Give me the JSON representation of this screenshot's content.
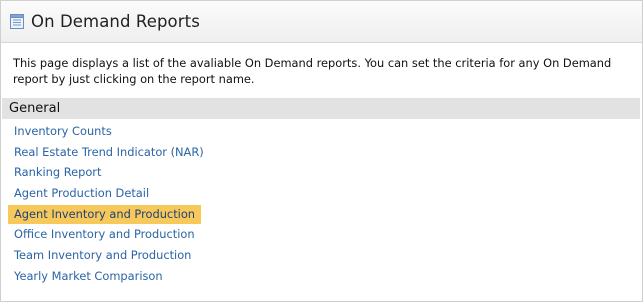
{
  "header": {
    "title": "On Demand Reports",
    "icon": "report-icon"
  },
  "description": "This page displays a list of the avaliable On Demand reports. You can set the criteria for any On Demand report by just clicking on the report name.",
  "section": {
    "title": "General",
    "items": [
      {
        "label": "Inventory Counts",
        "highlighted": false
      },
      {
        "label": "Real Estate Trend Indicator (NAR)",
        "highlighted": false
      },
      {
        "label": "Ranking Report",
        "highlighted": false
      },
      {
        "label": "Agent Production Detail",
        "highlighted": false
      },
      {
        "label": "Agent Inventory and Production",
        "highlighted": true
      },
      {
        "label": "Office Inventory and Production",
        "highlighted": false
      },
      {
        "label": "Team Inventory and Production",
        "highlighted": false
      },
      {
        "label": "Yearly Market Comparison",
        "highlighted": false
      }
    ]
  },
  "colors": {
    "link": "#2a64a6",
    "highlight": "#f7c95a",
    "section_bg": "#e2e2e2"
  }
}
